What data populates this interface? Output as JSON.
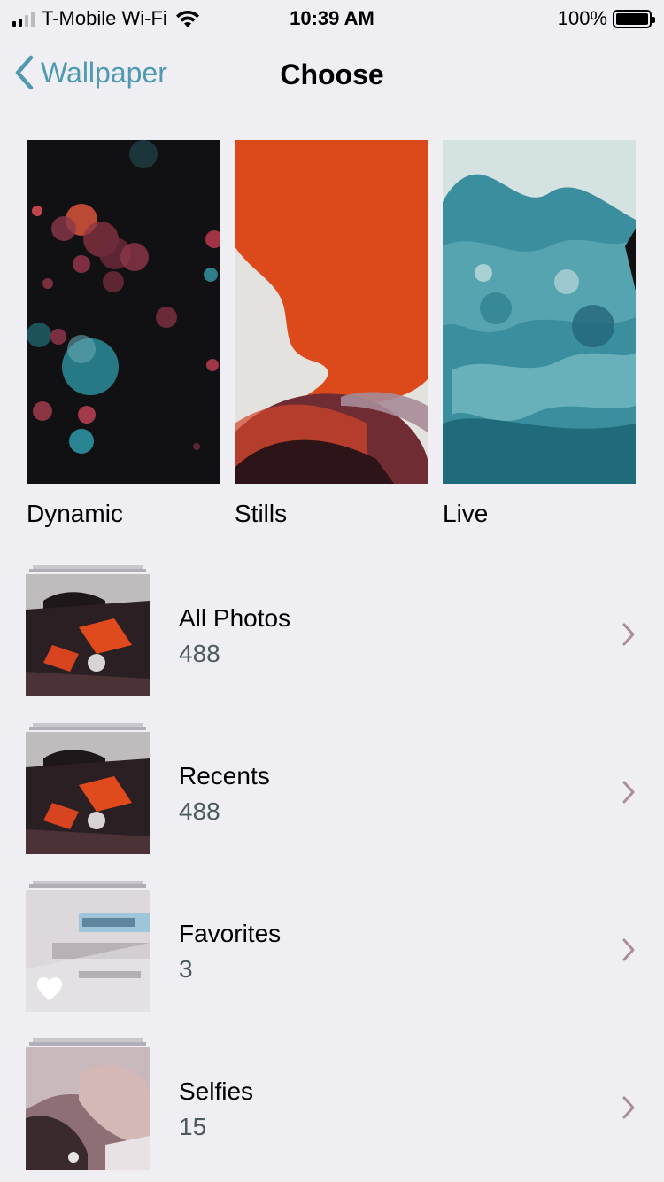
{
  "status_bar": {
    "carrier": "T-Mobile Wi-Fi",
    "time": "10:39 AM",
    "battery": "100%",
    "icons": [
      "signal-icon",
      "wifi-icon",
      "battery-icon"
    ]
  },
  "nav": {
    "back_label": "Wallpaper",
    "title": "Choose"
  },
  "categories": [
    {
      "label": "Dynamic"
    },
    {
      "label": "Stills"
    },
    {
      "label": "Live"
    }
  ],
  "albums": [
    {
      "title": "All Photos",
      "count": "488"
    },
    {
      "title": "Recents",
      "count": "488"
    },
    {
      "title": "Favorites",
      "count": "3"
    },
    {
      "title": "Selfies",
      "count": "15"
    }
  ],
  "colors": {
    "accent": "#4f9ab0",
    "background": "#efeef3",
    "chevron": "#a98e98"
  }
}
